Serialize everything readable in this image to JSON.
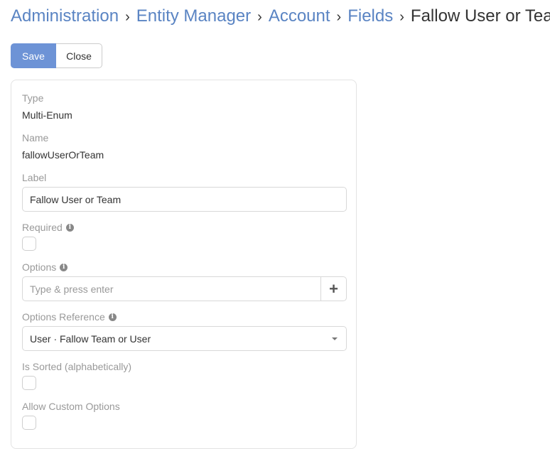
{
  "breadcrumb": {
    "items": [
      "Administration",
      "Entity Manager",
      "Account",
      "Fields"
    ],
    "separator": "›",
    "current": "Fallow User or Team"
  },
  "toolbar": {
    "save_label": "Save",
    "close_label": "Close"
  },
  "form": {
    "type": {
      "label": "Type",
      "value": "Multi-Enum"
    },
    "name": {
      "label": "Name",
      "value": "fallowUserOrTeam"
    },
    "label": {
      "label": "Label",
      "value": "Fallow User or Team"
    },
    "required": {
      "label": "Required",
      "checked": false
    },
    "options": {
      "label": "Options",
      "placeholder": "Type & press enter",
      "add_icon": "plus-icon"
    },
    "options_reference": {
      "label": "Options Reference",
      "value": "User · Fallow Team or User"
    },
    "is_sorted": {
      "label": "Is Sorted (alphabetically)",
      "checked": false
    },
    "allow_custom": {
      "label": "Allow Custom Options",
      "checked": false
    }
  },
  "colors": {
    "accent": "#5a84c3",
    "save_bg": "#6d93d6"
  }
}
